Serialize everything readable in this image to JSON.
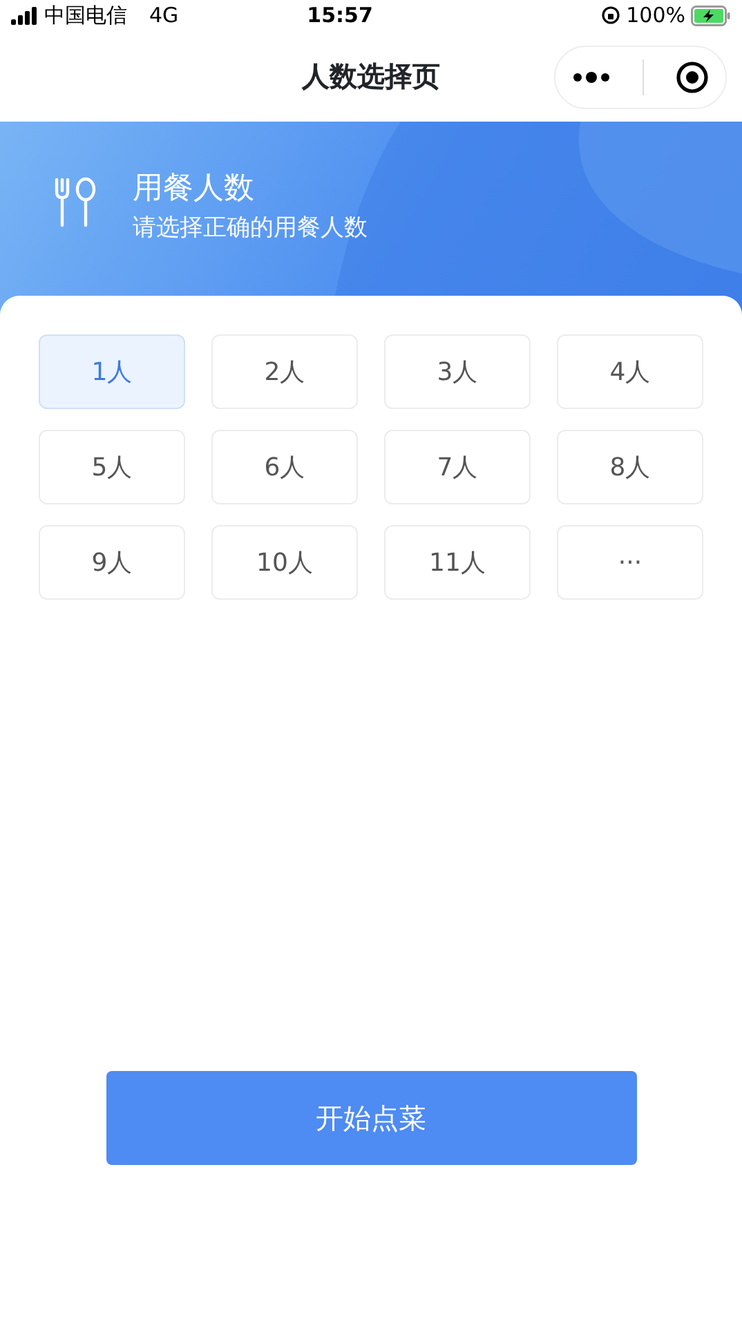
{
  "status_bar": {
    "carrier": "中国电信",
    "network": "4G",
    "time": "15:57",
    "battery": "100%"
  },
  "nav_bar": {
    "title": "人数选择页"
  },
  "header": {
    "title": "用餐人数",
    "subtitle": "请选择正确的用餐人数"
  },
  "options": [
    {
      "label": "1人",
      "selected": true
    },
    {
      "label": "2人",
      "selected": false
    },
    {
      "label": "3人",
      "selected": false
    },
    {
      "label": "4人",
      "selected": false
    },
    {
      "label": "5人",
      "selected": false
    },
    {
      "label": "6人",
      "selected": false
    },
    {
      "label": "7人",
      "selected": false
    },
    {
      "label": "8人",
      "selected": false
    },
    {
      "label": "9人",
      "selected": false
    },
    {
      "label": "10人",
      "selected": false
    },
    {
      "label": "11人",
      "selected": false
    },
    {
      "label": "···",
      "selected": false
    }
  ],
  "start_button": "开始点菜"
}
